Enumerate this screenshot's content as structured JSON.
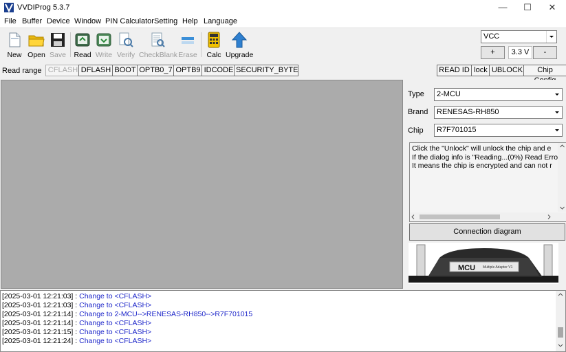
{
  "app": {
    "title": "VVDIProg 5.3.7",
    "minimize_symbol": "—",
    "maximize_symbol": "☐",
    "close_symbol": "✕"
  },
  "menu": [
    "File",
    "Buffer",
    "Device",
    "Window",
    "PIN Calculator",
    "Setting",
    "Help",
    "Language"
  ],
  "toolbar": {
    "buttons": [
      {
        "label": "New",
        "icon": "new-file-icon",
        "enabled": true
      },
      {
        "label": "Open",
        "icon": "folder-open-icon",
        "enabled": true
      },
      {
        "label": "Save",
        "icon": "floppy-disk-icon",
        "enabled": false
      },
      {
        "label": "Read",
        "icon": "chip-read-icon",
        "enabled": true
      },
      {
        "label": "Write",
        "icon": "chip-write-icon",
        "enabled": false
      },
      {
        "label": "Verify",
        "icon": "verify-icon",
        "enabled": false
      },
      {
        "label": "CheckBlank",
        "icon": "checkblank-icon",
        "enabled": false
      },
      {
        "label": "Erase",
        "icon": "erase-icon",
        "enabled": false
      },
      {
        "label": "Calc",
        "icon": "calculator-icon",
        "enabled": true
      },
      {
        "label": "Upgrade",
        "icon": "upgrade-arrow-icon",
        "enabled": true
      }
    ]
  },
  "vcc": {
    "selected": "VCC",
    "plus_label": "+",
    "minus_label": "-",
    "voltage": "3.3 V"
  },
  "read_range": {
    "label": "Read range",
    "buttons": [
      {
        "label": "CFLASH",
        "enabled": false
      },
      {
        "label": "DFLASH",
        "enabled": true
      },
      {
        "label": "BOOT",
        "enabled": true
      },
      {
        "label": "OPTB0_7",
        "enabled": true
      },
      {
        "label": "OPTB9",
        "enabled": true
      },
      {
        "label": "IDCODE",
        "enabled": true
      },
      {
        "label": "SECURITY_BYTE",
        "enabled": true
      }
    ],
    "right_buttons": [
      "READ ID",
      "lock",
      "UBLOCK",
      "Chip Config"
    ]
  },
  "chip_panel": {
    "type_label": "Type",
    "type_value": "2-MCU",
    "brand_label": "Brand",
    "brand_value": "RENESAS-RH850",
    "chip_label": "Chip",
    "chip_value": "R7F701015",
    "info_lines": [
      "Click the \"Unlock\" will unlock the chip and e",
      "If the dialog info is \"Reading...(0%) Read Erro",
      "It means the chip is encrypted and can not r"
    ],
    "connection_button": "Connection diagram",
    "image_text": "MCU",
    "image_subtext": "Multiple Adapter V1"
  },
  "log": [
    {
      "time": "[2025-03-01 12:21:03]",
      "sep": " : ",
      "msg": "Change to <CFLASH>"
    },
    {
      "time": "[2025-03-01 12:21:03]",
      "sep": " : ",
      "msg": "Change to <CFLASH>"
    },
    {
      "time": "[2025-03-01 12:21:14]",
      "sep": " : ",
      "msg": "Change to 2-MCU-->RENESAS-RH850-->R7F701015"
    },
    {
      "time": "[2025-03-01 12:21:14]",
      "sep": " : ",
      "msg": "Change to <CFLASH>"
    },
    {
      "time": "[2025-03-01 12:21:15]",
      "sep": " : ",
      "msg": "Change to <CFLASH>"
    },
    {
      "time": "[2025-03-01 12:21:24]",
      "sep": " : ",
      "msg": "Change to <CFLASH>"
    }
  ],
  "colors": {
    "log_message": "#1c25c9",
    "hex_background": "#ababab",
    "disabled_text": "#9a9a9a"
  }
}
